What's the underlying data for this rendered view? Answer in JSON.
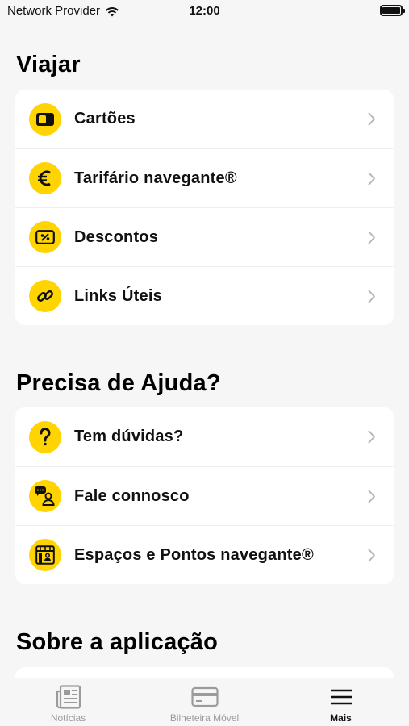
{
  "status_bar": {
    "carrier": "Network Provider",
    "time": "12:00"
  },
  "sections": [
    {
      "title": "Viajar",
      "items": [
        {
          "label": "Cartões",
          "icon": "card-icon"
        },
        {
          "label": "Tarifário navegante®",
          "icon": "euro-icon"
        },
        {
          "label": "Descontos",
          "icon": "discount-ticket-icon"
        },
        {
          "label": "Links Úteis",
          "icon": "link-icon"
        }
      ]
    },
    {
      "title": "Precisa de Ajuda?",
      "items": [
        {
          "label": "Tem dúvidas?",
          "icon": "question-icon"
        },
        {
          "label": "Fale connosco",
          "icon": "chat-person-icon"
        },
        {
          "label": "Espaços e Pontos navegante®",
          "icon": "store-icon"
        }
      ]
    },
    {
      "title": "Sobre a aplicação",
      "items": []
    }
  ],
  "tab_bar": {
    "tabs": [
      {
        "label": "Notícias",
        "icon": "newspaper-icon",
        "active": false
      },
      {
        "label": "Bilheteira Móvel",
        "icon": "ticket-card-icon",
        "active": false
      },
      {
        "label": "Mais",
        "icon": "menu-icon",
        "active": true
      }
    ]
  },
  "colors": {
    "accent": "#ffd400",
    "background": "#f6f6f6",
    "card": "#ffffff",
    "inactive_tab": "#9b9b9b"
  }
}
